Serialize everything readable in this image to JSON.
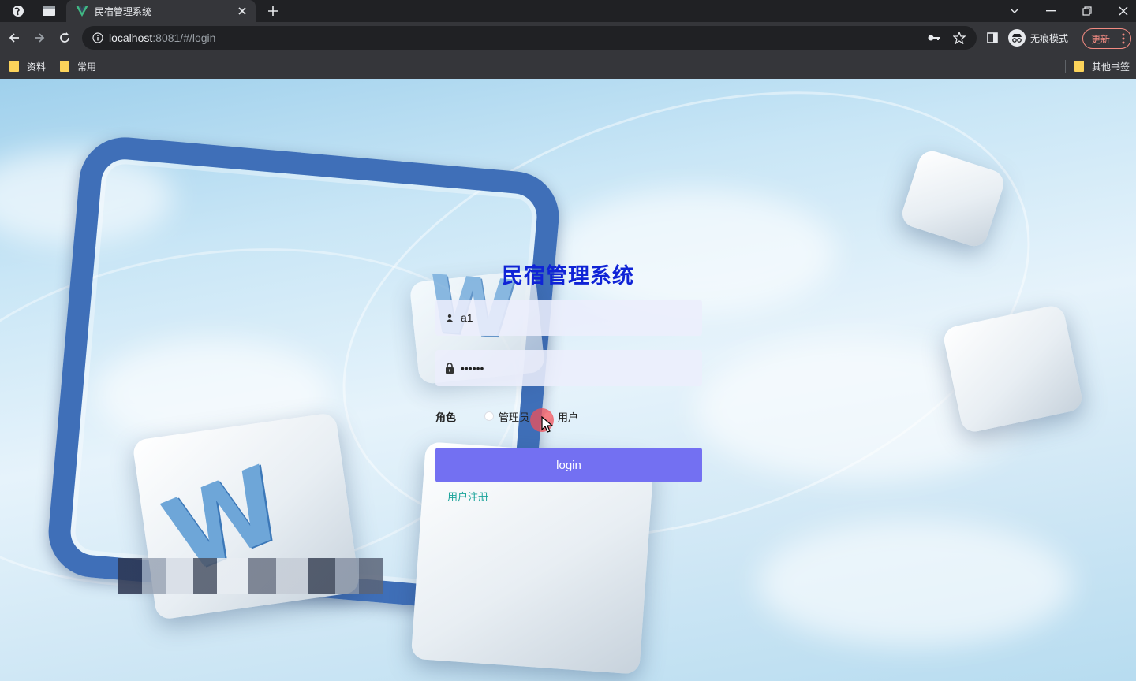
{
  "browser": {
    "tab": {
      "title": "民宿管理系统"
    },
    "address": {
      "host": "localhost",
      "rest": ":8081/#/login"
    },
    "profile_label": "无痕模式",
    "update_label": "更新",
    "bookmarks": [
      "资料",
      "常用"
    ],
    "other_bookmarks": "其他书签"
  },
  "icons": {
    "globe": "globe-icon",
    "tab_search": "tab-search-icon",
    "favicon": "vue-logo-icon",
    "close": "close-icon",
    "new_tab": "plus-icon",
    "back": "arrow-left-icon",
    "forward": "arrow-right-icon",
    "reload": "reload-icon",
    "info": "info-icon",
    "key": "key-icon",
    "star": "star-icon",
    "side_panel": "side-panel-icon",
    "incognito": "incognito-icon",
    "menu": "kebab-menu-icon",
    "user": "user-icon",
    "lock": "lock-icon"
  },
  "login": {
    "title": "民宿管理系统",
    "username_value": "a1",
    "password_value": "••••••",
    "role_label": "角色",
    "roles": [
      "管理员",
      "用户"
    ],
    "submit_label": "login",
    "register_label": "用户注册"
  },
  "colors": {
    "title": "#0f23d6",
    "button": "#7370f2",
    "register_link": "#1aa39a"
  }
}
